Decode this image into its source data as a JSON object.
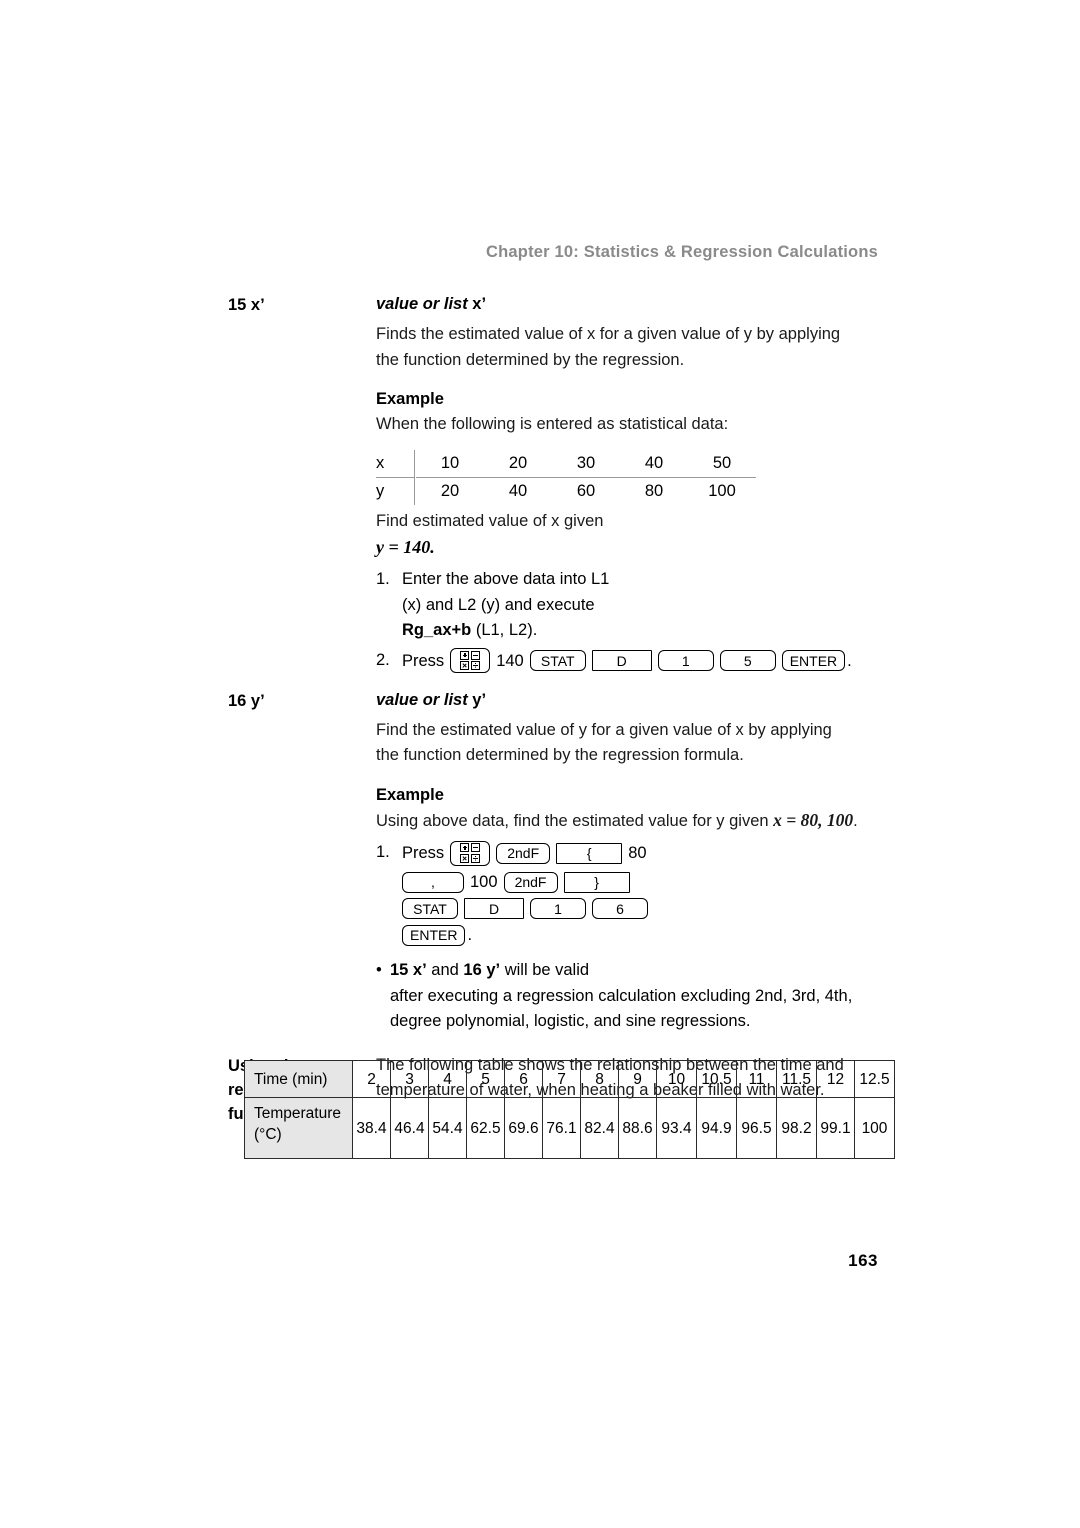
{
  "header": {
    "running_title": "Chapter 10: Statistics & Regression Calculations"
  },
  "sections": {
    "x_prime": {
      "term": "15 x’",
      "title_italic": "value or list",
      "title_suffix": "x’",
      "description_line1": "Finds the estimated value of x for a given value of y by applying",
      "description_line2": "the function determined by the regression.",
      "example_heading": "Example",
      "example_intro": "When the following is entered as statistical data:",
      "find_line": "Find estimated value of x given",
      "given_value": "y = 140.",
      "step1_num": "1.",
      "step1_line1": "Enter the above data into L1",
      "step1_line2": "(x) and L2 (y) and execute",
      "step1_cmd_bold": "Rg_ax+b",
      "step1_cmd_rest": " (L1, L2).",
      "step2_num": "2.",
      "step2_label": "Press",
      "step2_value": "140",
      "step2_period": "."
    },
    "y_prime": {
      "term": "16 y’",
      "title_italic": "value or list",
      "title_suffix": "y’",
      "description_line1": "Find the estimated value of y for a given value of x by applying",
      "description_line2": "the function determined by the regression formula.",
      "example_heading": "Example",
      "example_text_pre": "Using above data, find the estimated value for y given ",
      "example_text_math": "x = 80, 100",
      "example_text_post": ".",
      "step1_num": "1.",
      "step1_label": "Press",
      "value_80": "80",
      "value_100": "100"
    },
    "note": {
      "bullet": "•",
      "line1_bold_a": "15 x’",
      "line1_mid": " and ",
      "line1_bold_b": "16 y’",
      "line1_tail": " will be valid",
      "line2": "after executing a regression calculation excluding 2nd, 3rd, 4th,",
      "line3": "degree polynomial, logistic, and sine regressions."
    },
    "using_regression": {
      "term_line1": "Using the",
      "term_line2": "regression",
      "term_line3": "functions",
      "paragraph_line1": "The following table shows the relationship between the time and",
      "paragraph_line2": "temperature of water, when heating a beaker filled with water."
    }
  },
  "xy_table": {
    "row_x_label": "x",
    "row_y_label": "y",
    "row_x_values": [
      "10",
      "20",
      "30",
      "40",
      "50"
    ],
    "row_y_values": [
      "20",
      "40",
      "60",
      "80",
      "100"
    ]
  },
  "keys": {
    "math_icon": "math-operator-grid-icon",
    "stat": "STAT",
    "d": "D",
    "one": "1",
    "five": "5",
    "six": "6",
    "enter": "ENTER",
    "second_f": "2ndF",
    "brace_open": "{",
    "brace_close": "}",
    "comma": ","
  },
  "temp_table": {
    "row_labels": [
      "Time (min)",
      "Temperature (°C)"
    ],
    "time_label_text": "Time (min)",
    "temp_label_line1": "Temperature",
    "temp_label_line2": "(°C)",
    "times": [
      "2",
      "3",
      "4",
      "5",
      "6",
      "7",
      "8",
      "9",
      "10",
      "10.5",
      "11",
      "11.5",
      "12",
      "12.5"
    ],
    "temperatures": [
      "38.4",
      "46.4",
      "54.4",
      "62.5",
      "69.6",
      "76.1",
      "82.4",
      "88.6",
      "93.4",
      "94.9",
      "96.5",
      "98.2",
      "99.1",
      "100"
    ]
  },
  "footer": {
    "page_number": "163"
  },
  "colors": {
    "header_gray": "#8a8a8a",
    "table_label_bg": "#e6e6e6",
    "rule_gray": "#9a9a9a",
    "text": "#000000"
  }
}
